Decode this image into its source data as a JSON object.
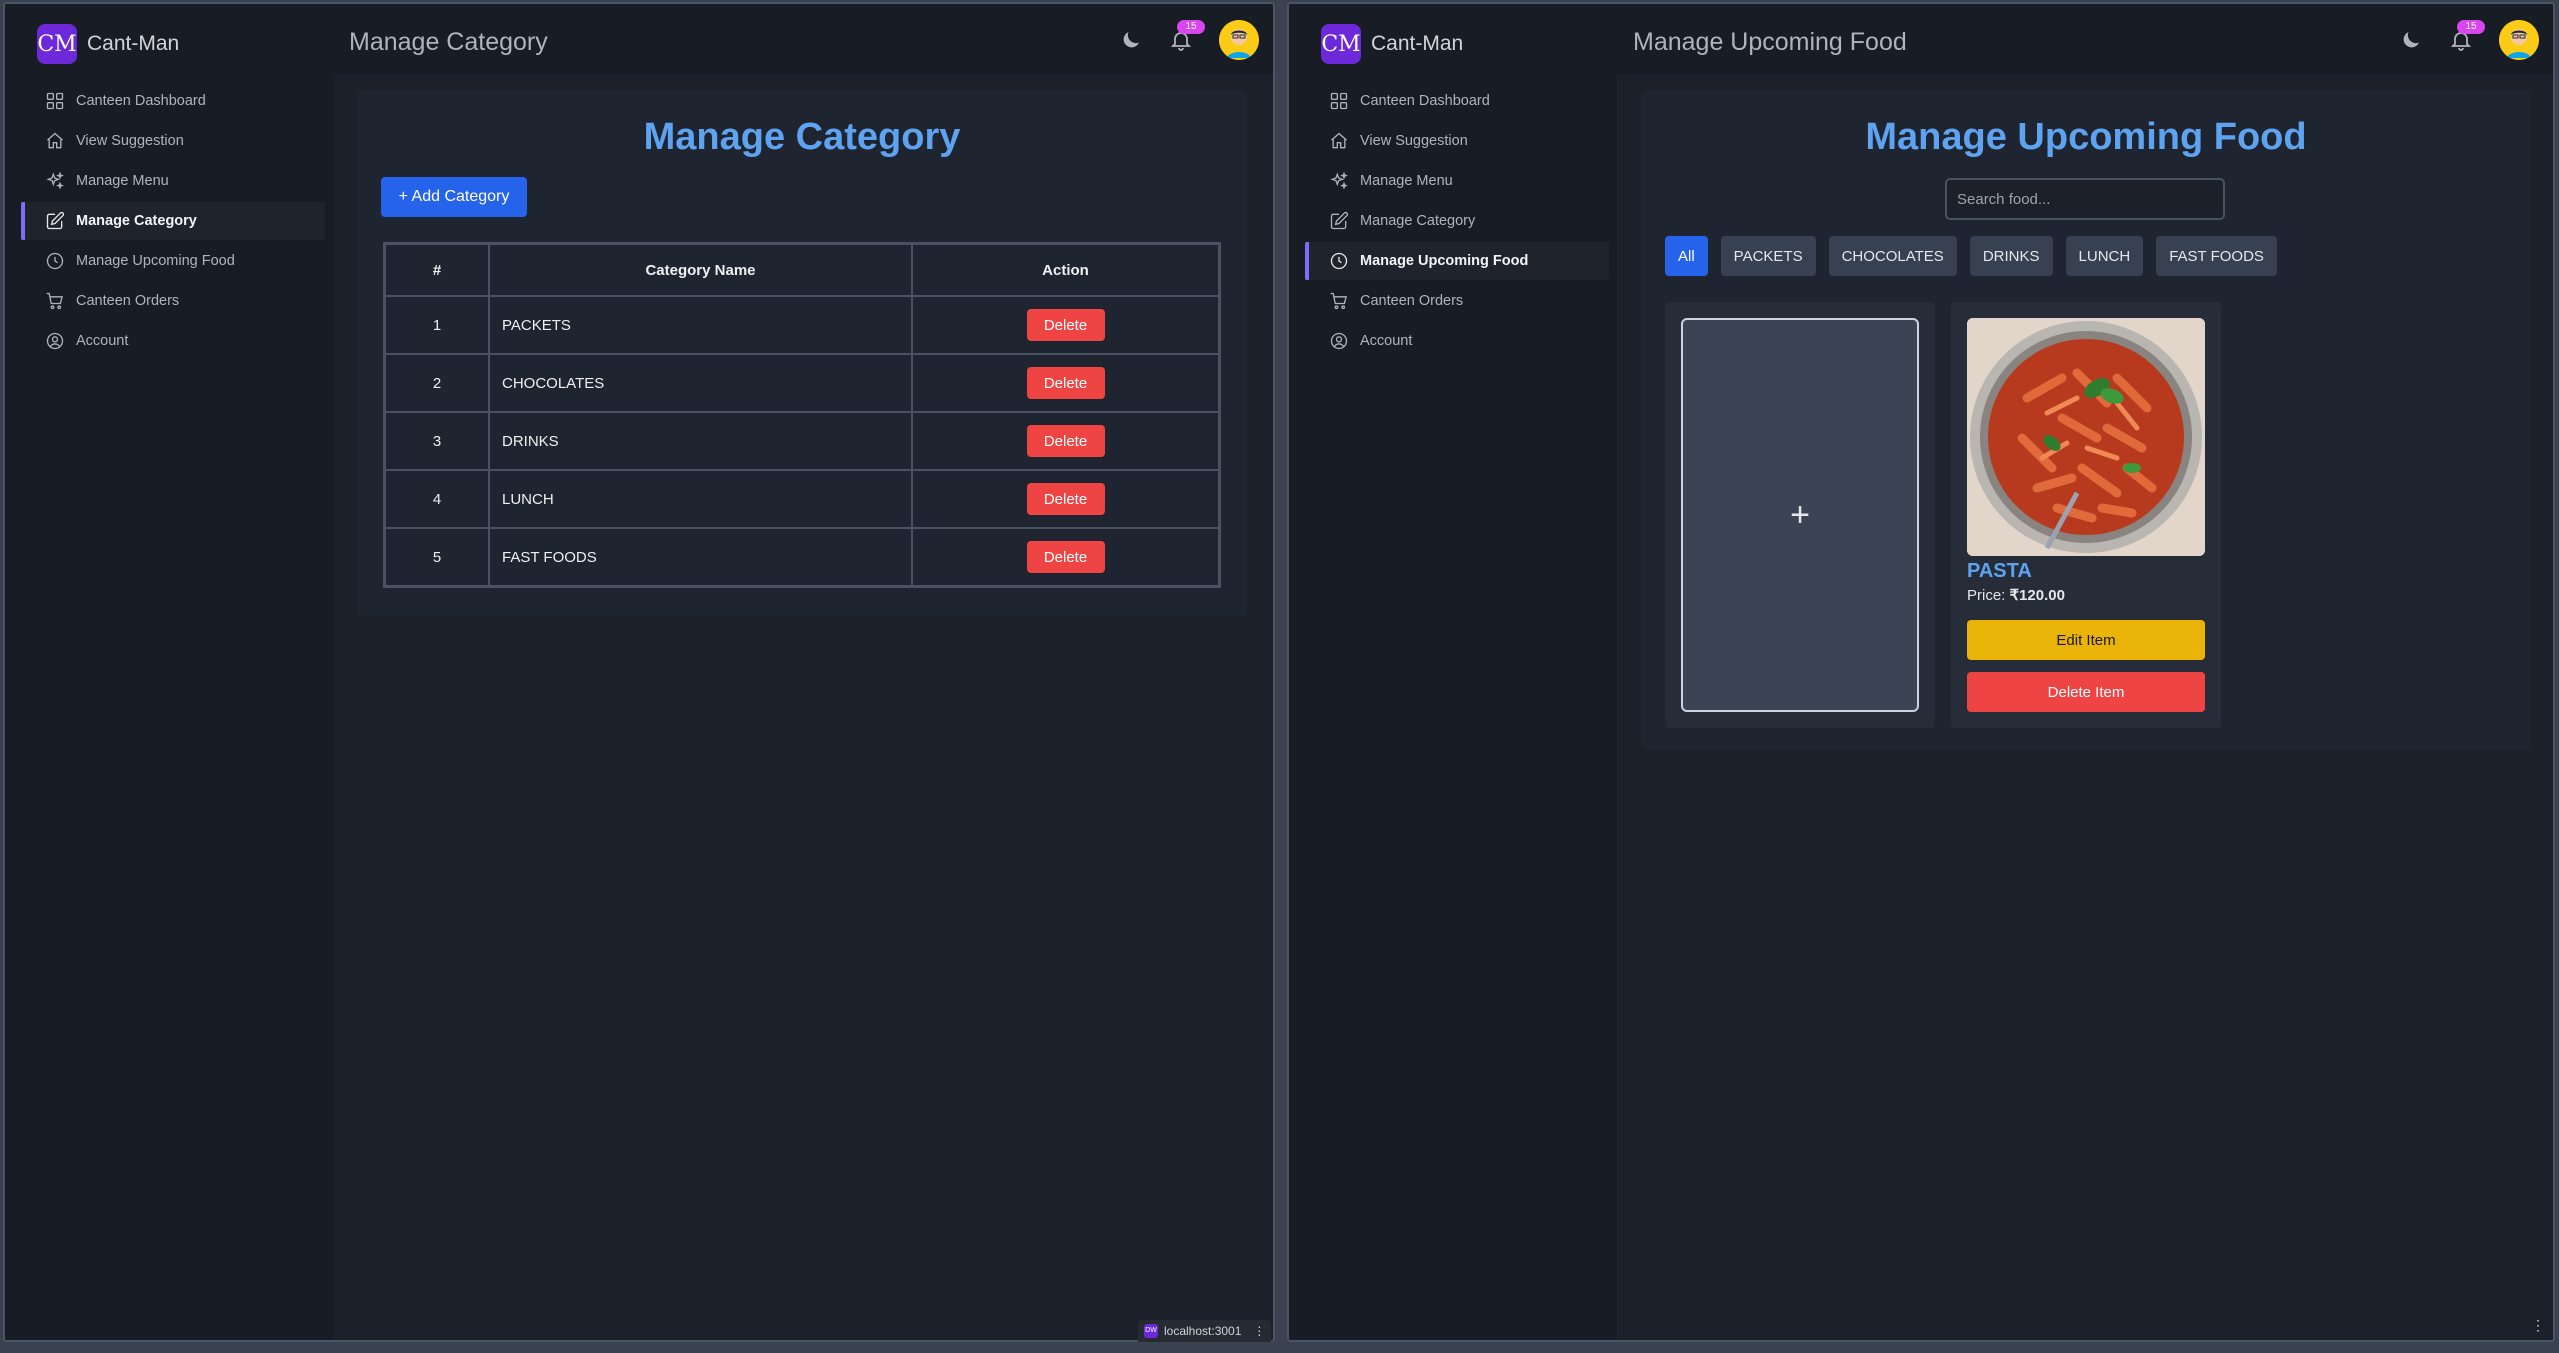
{
  "left": {
    "brand": {
      "logo": "CM",
      "name": "Cant-Man"
    },
    "nav": [
      {
        "label": "Canteen Dashboard",
        "icon": "grid-icon"
      },
      {
        "label": "View Suggestion",
        "icon": "home-icon"
      },
      {
        "label": "Manage Menu",
        "icon": "sparkle-icon"
      },
      {
        "label": "Manage Category",
        "icon": "edit-icon",
        "active": true
      },
      {
        "label": "Manage Upcoming Food",
        "icon": "clock-icon"
      },
      {
        "label": "Canteen Orders",
        "icon": "cart-icon"
      },
      {
        "label": "Account",
        "icon": "user-circle-icon"
      }
    ],
    "header": {
      "title": "Manage Category",
      "notifications": "15"
    },
    "content": {
      "title": "Manage Category",
      "add_button": "+ Add Category",
      "table": {
        "headers": [
          "#",
          "Category Name",
          "Action"
        ],
        "rows": [
          {
            "num": "1",
            "name": "PACKETS",
            "action": "Delete"
          },
          {
            "num": "2",
            "name": "CHOCOLATES",
            "action": "Delete"
          },
          {
            "num": "3",
            "name": "DRINKS",
            "action": "Delete"
          },
          {
            "num": "4",
            "name": "LUNCH",
            "action": "Delete"
          },
          {
            "num": "5",
            "name": "FAST FOODS",
            "action": "Delete"
          }
        ]
      }
    },
    "host_chip": {
      "badge": "DW",
      "label": "localhost:3001"
    }
  },
  "right": {
    "brand": {
      "logo": "CM",
      "name": "Cant-Man"
    },
    "nav": [
      {
        "label": "Canteen Dashboard"
      },
      {
        "label": "View Suggestion"
      },
      {
        "label": "Manage Menu"
      },
      {
        "label": "Manage Category"
      },
      {
        "label": "Manage Upcoming Food",
        "active": true
      },
      {
        "label": "Canteen Orders"
      },
      {
        "label": "Account"
      }
    ],
    "header": {
      "title": "Manage Upcoming Food",
      "notifications": "15"
    },
    "content": {
      "title": "Manage Upcoming Food",
      "search_placeholder": "Search food...",
      "filters": [
        "All",
        "PACKETS",
        "CHOCOLATES",
        "DRINKS",
        "LUNCH",
        "FAST FOODS"
      ],
      "active_filter": "All",
      "add_tile": "+",
      "food": {
        "name": "PASTA",
        "price_label": "Price:",
        "price": "₹120.00",
        "edit": "Edit Item",
        "delete": "Delete Item"
      }
    }
  },
  "colors": {
    "accent": "#5da3f0",
    "primary": "#2563eb",
    "danger": "#ef4444",
    "warning": "#eab308",
    "brand": "#6d28d9"
  }
}
